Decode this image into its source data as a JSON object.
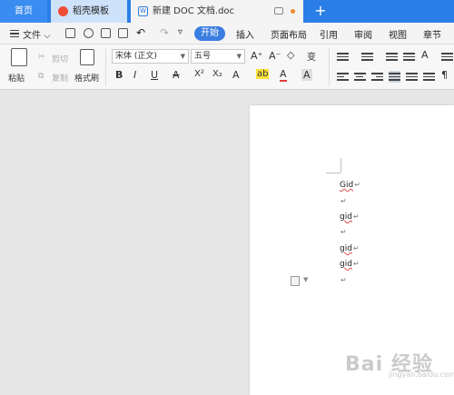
{
  "tabs": {
    "home": "首页",
    "templates": "稻壳模板",
    "document": "新建 DOC 文档.doc",
    "new_tab": "+"
  },
  "menubar": {
    "file": "文件",
    "items": [
      "开始",
      "插入",
      "页面布局",
      "引用",
      "审阅",
      "视图",
      "章节"
    ]
  },
  "ribbon": {
    "paste": "粘贴",
    "cut": "剪切",
    "copy": "复制",
    "format_painter": "格式刷",
    "font_family": "宋体 (正文)",
    "font_size": "五号",
    "bold": "B",
    "italic": "I",
    "underline": "U",
    "strike": "A",
    "superscript": "X²",
    "subscript": "X₂",
    "font_grow": "A⁺",
    "font_shrink": "A⁻",
    "clear": "◇",
    "phonetic": "变",
    "text_effect": "A",
    "highlight": "ab",
    "font_color": "A",
    "char_shade": "A"
  },
  "document": {
    "lines": [
      {
        "text": "Gid",
        "mark": "↵"
      },
      {
        "text": "",
        "mark": "↵"
      },
      {
        "text": "gid",
        "mark": "↵"
      },
      {
        "text": "",
        "mark": "↵"
      },
      {
        "text": "gid",
        "mark": "↵"
      },
      {
        "text": "gid",
        "mark": "↵"
      },
      {
        "text": "",
        "mark": "↵"
      }
    ]
  },
  "watermark": {
    "brand": "Bai 经验",
    "sub": "jingyan.baidu.com"
  },
  "colors": {
    "tab_bar": "#2a7ee6",
    "start_button": "#3b7ee0",
    "underline_red": "#e23a3a",
    "highlight_yellow": "#fbe23b"
  }
}
